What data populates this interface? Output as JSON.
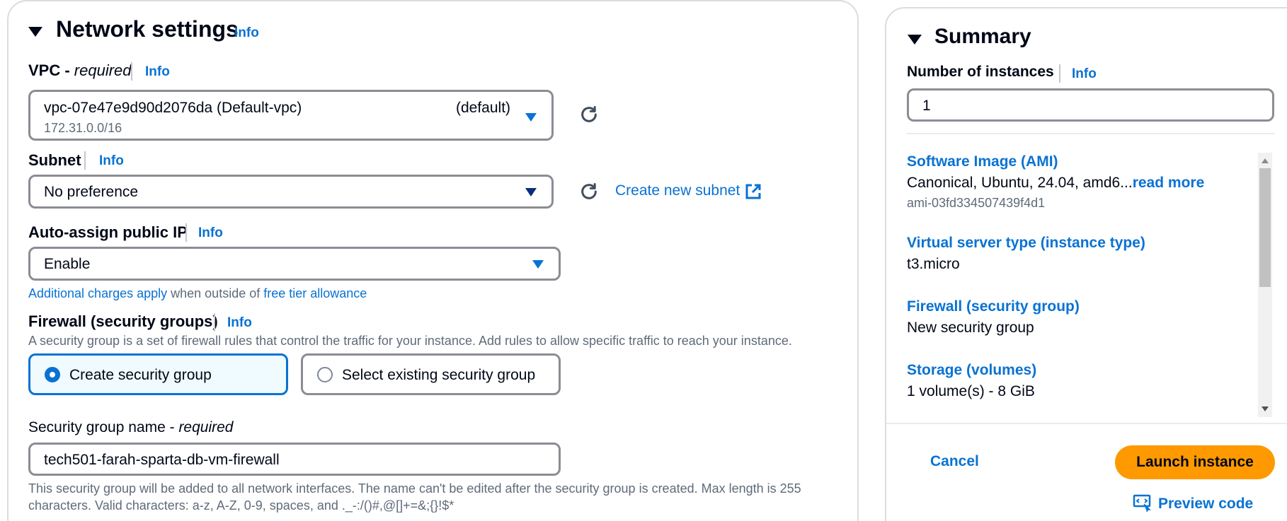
{
  "network": {
    "title": "Network settings",
    "info": "Info",
    "vpc": {
      "label": "VPC - ",
      "required": "required",
      "info": "Info",
      "value": "vpc-07e47e9d90d2076da (Default-vpc)",
      "tag": "(default)",
      "cidr": "172.31.0.0/16"
    },
    "subnet": {
      "label": "Subnet",
      "info": "Info",
      "value": "No preference",
      "create_link": "Create new subnet"
    },
    "public_ip": {
      "label": "Auto-assign public IP",
      "info": "Info",
      "value": "Enable",
      "charges_link": "Additional charges apply",
      "charges_mid": " when outside of ",
      "free_tier_link": "free tier allowance"
    },
    "firewall": {
      "label": "Firewall (security groups)",
      "info": "Info",
      "description": "A security group is a set of firewall rules that control the traffic for your instance. Add rules to allow specific traffic to reach your instance.",
      "options": [
        {
          "label": "Create security group",
          "selected": true
        },
        {
          "label": "Select existing security group",
          "selected": false
        }
      ]
    },
    "sg_name": {
      "label": "Security group name - ",
      "required": "required",
      "value": "tech501-farah-sparta-db-vm-firewall",
      "help_line1": "This security group will be added to all network interfaces. The name can't be edited after the security group is created. Max length is 255",
      "help_line2": "characters. Valid characters: a-z, A-Z, 0-9, spaces, and ._-:/()#,@[]+=&;{}!$*"
    }
  },
  "summary": {
    "title": "Summary",
    "instances": {
      "label": "Number of instances",
      "info": "Info",
      "value": "1"
    },
    "items": [
      {
        "title": "Software Image (AMI)",
        "value": "Canonical, Ubuntu, 24.04, amd6...",
        "more": "read more",
        "sub": "ami-03fd334507439f4d1"
      },
      {
        "title": "Virtual server type (instance type)",
        "value": "t3.micro"
      },
      {
        "title": "Firewall (security group)",
        "value": "New security group"
      },
      {
        "title": "Storage (volumes)",
        "value": "1 volume(s) - 8 GiB"
      }
    ],
    "cancel": "Cancel",
    "launch": "Launch instance",
    "preview": "Preview code"
  },
  "colors": {
    "link": "#0972d3",
    "launch_button": "#ff9900",
    "selected_tile_bg": "#f0fbff",
    "border": "#8c8c94"
  }
}
